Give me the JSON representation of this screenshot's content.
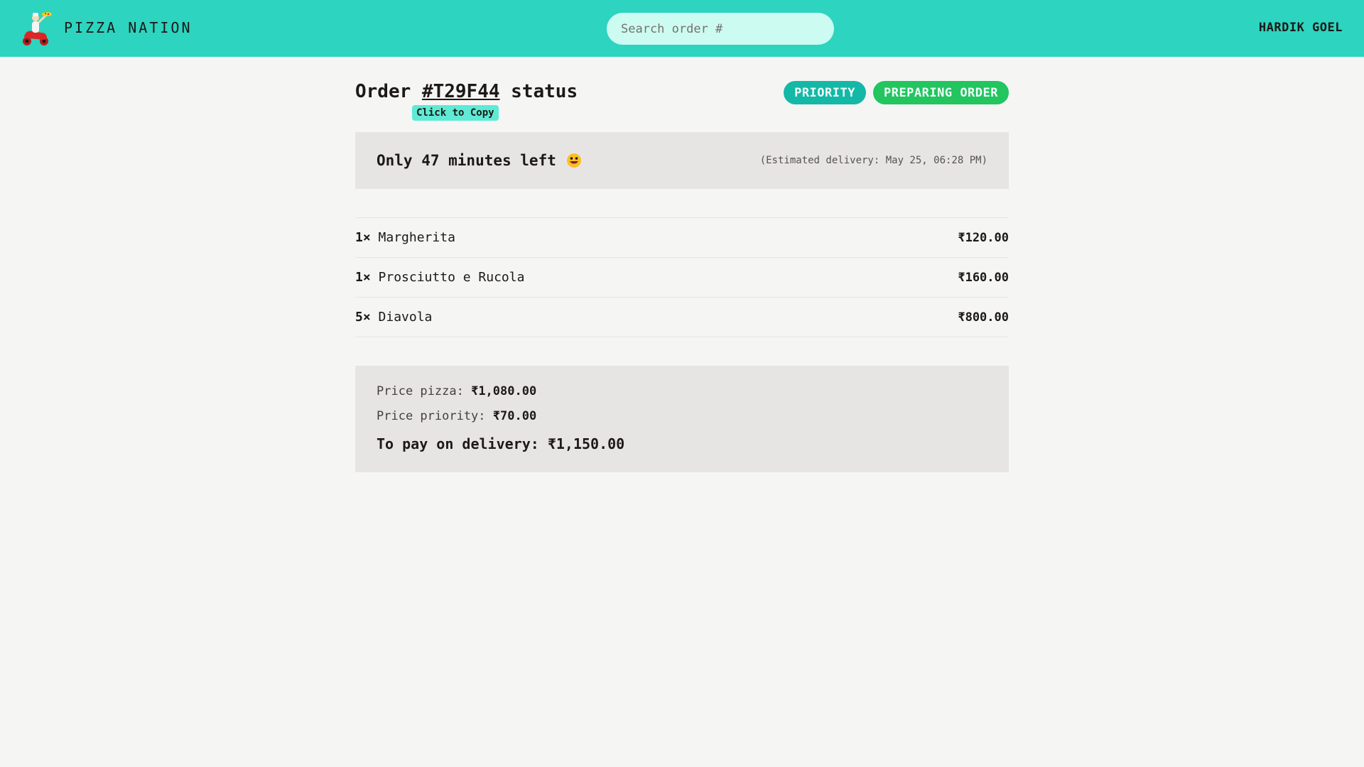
{
  "header": {
    "brand": "PIZZA NATION",
    "search_placeholder": "Search order #",
    "username": "HARDIK GOEL"
  },
  "order": {
    "title_prefix": "Order",
    "order_id": "#T29F44",
    "title_suffix": "status",
    "copy_tooltip": "Click to Copy",
    "badges": {
      "priority": "PRIORITY",
      "status": "PREPARING ORDER"
    },
    "eta": {
      "message": "Only 47 minutes left",
      "estimated": "(Estimated delivery: May 25, 06:28 PM)"
    },
    "items": [
      {
        "qty": "1×",
        "name": "Margherita",
        "price": "₹120.00"
      },
      {
        "qty": "1×",
        "name": "Prosciutto e Rucola",
        "price": "₹160.00"
      },
      {
        "qty": "5×",
        "name": "Diavola",
        "price": "₹800.00"
      }
    ],
    "summary": {
      "pizza_label": "Price pizza:",
      "pizza_value": "₹1,080.00",
      "priority_label": "Price priority:",
      "priority_value": "₹70.00",
      "total_label": "To pay on delivery:",
      "total_value": "₹1,150.00"
    }
  },
  "colors": {
    "header_bg": "#2dd4bf",
    "priority_badge": "#14b8a6",
    "status_badge": "#22c55e"
  }
}
